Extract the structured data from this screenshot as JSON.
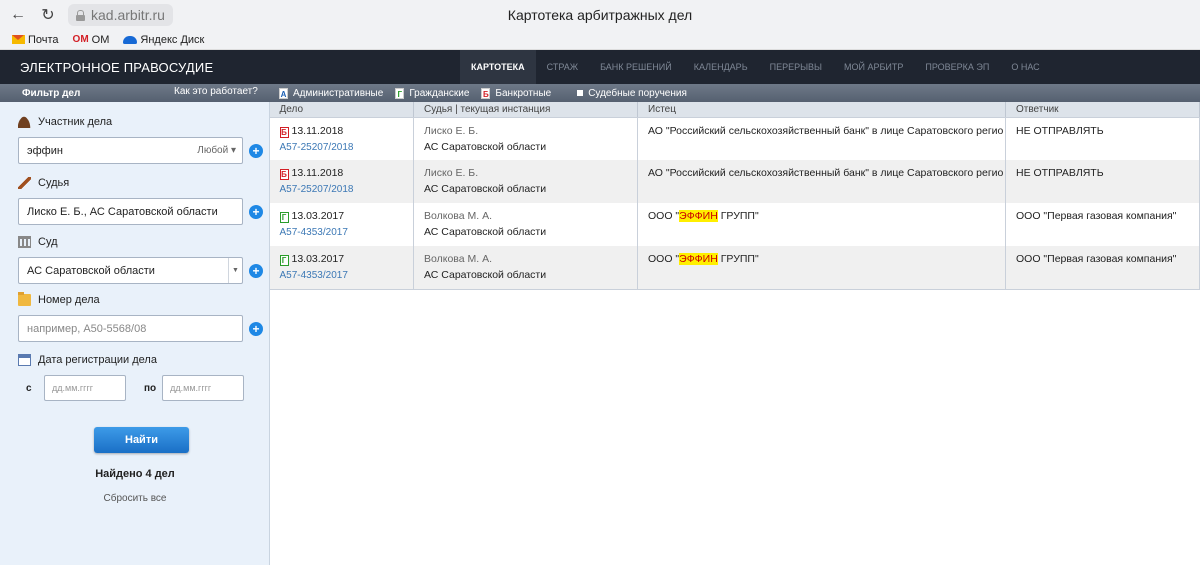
{
  "browser": {
    "url": "kad.arbitr.ru",
    "page_title": "Картотека арбитражных дел",
    "bookmarks": [
      "Почта",
      "ОМ",
      "Яндекс Диск"
    ]
  },
  "site": {
    "logo": "ЭЛЕКТРОННОЕ ПРАВОСУДИЕ",
    "nav": [
      "КАРТОТЕКА",
      "СТРАЖ",
      "БАНК РЕШЕНИЙ",
      "КАЛЕНДАРЬ",
      "ПЕРЕРЫВЫ",
      "МОЙ АРБИТР",
      "ПРОВЕРКА ЭП",
      "О НАС"
    ],
    "active_nav": "КАРТОТЕКА"
  },
  "filter_bar": {
    "title": "Фильтр дел",
    "how": "Как это работает?",
    "case_types": [
      {
        "icon": "А",
        "label": "Административные"
      },
      {
        "icon": "Г",
        "label": "Гражданские"
      },
      {
        "icon": "Б",
        "label": "Банкротные"
      },
      {
        "label": "Судебные поручения"
      }
    ]
  },
  "sidebar": {
    "participant": {
      "label": "Участник дела",
      "value": "эффин",
      "role": "Любой"
    },
    "judge": {
      "label": "Судья",
      "value": "Лиско Е. Б., АС Саратовской области"
    },
    "court": {
      "label": "Суд",
      "value": "АС Саратовской области"
    },
    "case_number": {
      "label": "Номер дела",
      "placeholder": "например, А50-5568/08"
    },
    "reg_date": {
      "label": "Дата регистрации дела",
      "from_label": "с",
      "to_label": "по",
      "from_placeholder": "дд.мм.гггг",
      "to_placeholder": "дд.мм.гггг"
    },
    "find_button": "Найти",
    "found": "Найдено 4 дел",
    "reset": "Сбросить все"
  },
  "table": {
    "headers": [
      "Дело",
      "Судья | текущая инстанция",
      "Истец",
      "Ответчик"
    ],
    "rows": [
      {
        "type": "Б",
        "date": "13.11.2018",
        "number": "А57-25207/2018",
        "judge": "Лиско Е. Б.",
        "court": "АС Саратовской области",
        "plaintiff_pre": "АО \"Российский сельскохозяйственный банк\" в лице Саратовского регио",
        "plaintiff_hl": "",
        "plaintiff_post": "",
        "defendant": "НЕ ОТПРАВЛЯТЬ"
      },
      {
        "type": "Б",
        "date": "13.11.2018",
        "number": "А57-25207/2018",
        "judge": "Лиско Е. Б.",
        "court": "АС Саратовской области",
        "plaintiff_pre": "АО \"Российский сельскохозяйственный банк\" в лице Саратовского регио",
        "plaintiff_hl": "",
        "plaintiff_post": "",
        "defendant": "НЕ ОТПРАВЛЯТЬ"
      },
      {
        "type": "Г",
        "date": "13.03.2017",
        "number": "А57-4353/2017",
        "judge": "Волкова М. А.",
        "court": "АС Саратовской области",
        "plaintiff_pre": "ООО \"",
        "plaintiff_hl": "ЭФФИН",
        "plaintiff_post": " ГРУПП\"",
        "defendant": "ООО \"Первая газовая компания\""
      },
      {
        "type": "Г",
        "date": "13.03.2017",
        "number": "А57-4353/2017",
        "judge": "Волкова М. А.",
        "court": "АС Саратовской области",
        "plaintiff_pre": "ООО \"",
        "plaintiff_hl": "ЭФФИН",
        "plaintiff_post": " ГРУПП\"",
        "defendant": "ООО \"Первая газовая компания\""
      }
    ]
  }
}
